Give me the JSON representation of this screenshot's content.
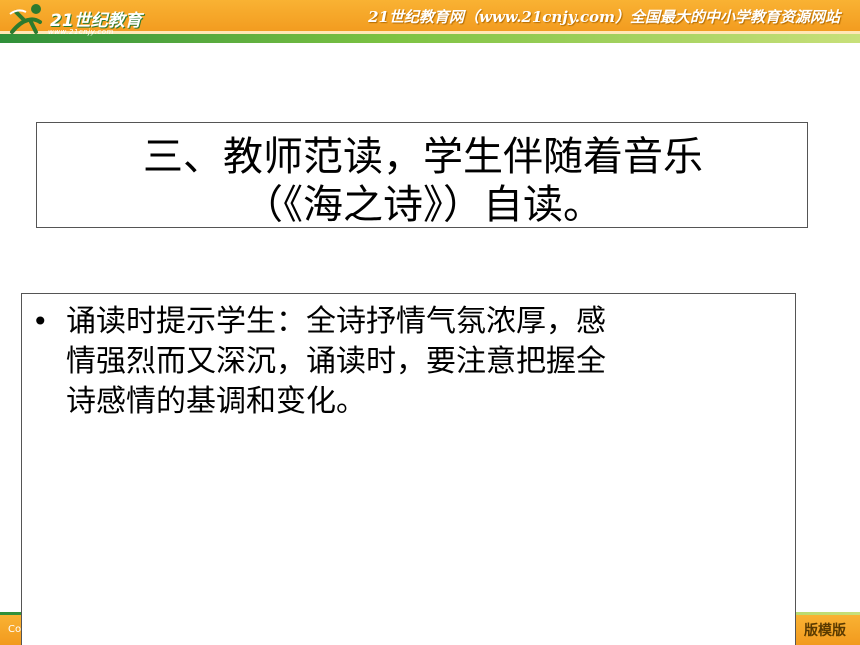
{
  "header": {
    "logo_text": "21世纪教育",
    "logo_url": "www.21cnjy.com",
    "slogan": "21世纪教育网（www.21cnjy.com）全国最大的中小学教育资源网站"
  },
  "slide": {
    "title_line1": "三、教师范读，学生伴随着音乐",
    "title_line2": "（《海之诗》）自读。",
    "bullets": [
      {
        "line1": "诵读时提示学生：全诗抒情气氛浓厚，感",
        "line2": "情强烈而又深沉，诵读时，要注意把握全",
        "line3": "诗感情的基调和变化。"
      }
    ]
  },
  "footer": {
    "left_text": "Co",
    "right_text": "版模版"
  },
  "colors": {
    "header_orange": "#f29a1e",
    "header_green": "#7cc242",
    "text": "#000000"
  }
}
